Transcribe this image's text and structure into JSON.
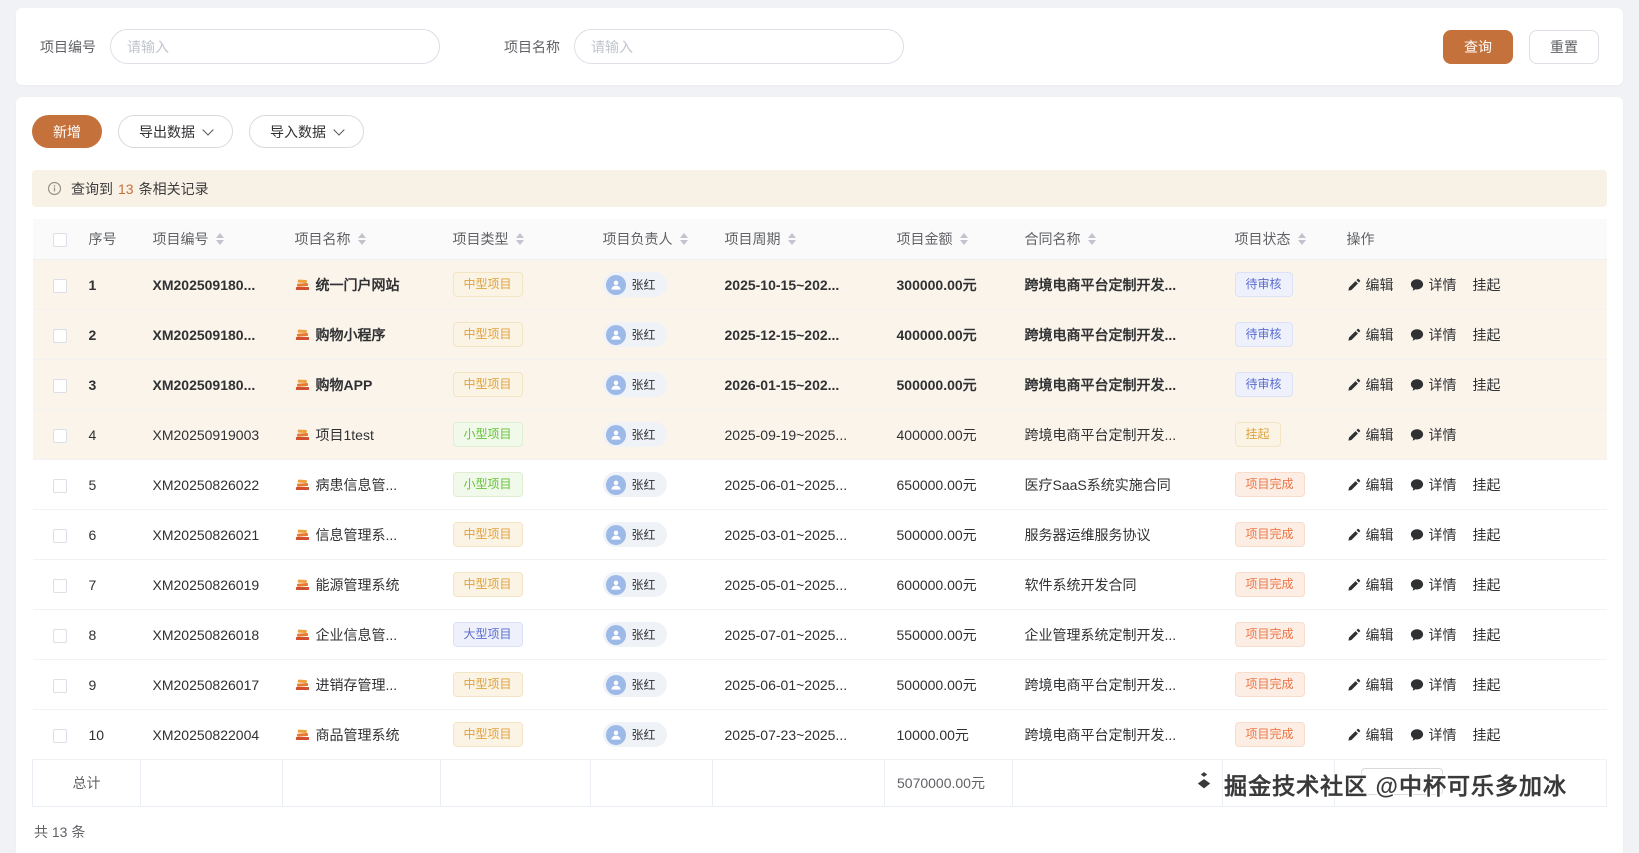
{
  "search": {
    "project_code_label": "项目编号",
    "project_code_placeholder": "请输入",
    "project_name_label": "项目名称",
    "project_name_placeholder": "请输入",
    "query_button": "查询",
    "reset_button": "重置"
  },
  "toolbar": {
    "add_button": "新增",
    "export_button": "导出数据",
    "import_button": "导入数据"
  },
  "alert": {
    "text_prefix": "查询到",
    "count": "13",
    "text_suffix": "条相关记录"
  },
  "table": {
    "columns": [
      {
        "label": "序号",
        "sortable": false
      },
      {
        "label": "项目编号",
        "sortable": true
      },
      {
        "label": "项目名称",
        "sortable": true
      },
      {
        "label": "项目类型",
        "sortable": true
      },
      {
        "label": "项目负责人",
        "sortable": true
      },
      {
        "label": "项目周期",
        "sortable": true
      },
      {
        "label": "项目金额",
        "sortable": true
      },
      {
        "label": "合同名称",
        "sortable": true
      },
      {
        "label": "项目状态",
        "sortable": true
      },
      {
        "label": "操作",
        "sortable": false
      }
    ],
    "action_defs": {
      "edit": {
        "label": "编辑",
        "icon": "pencil-icon"
      },
      "detail": {
        "label": "详情",
        "icon": "chat-icon"
      },
      "suspend": {
        "label": "挂起",
        "icon": null
      }
    },
    "rows": [
      {
        "index": "1",
        "code": "XM202509180...",
        "name": "统一门户网站",
        "type": "中型项目",
        "type_variant": "warning",
        "owner": "张红",
        "period": "2025-10-15~202...",
        "amount": "300000.00元",
        "contract": "跨境电商平台定制开发...",
        "status": "待审核",
        "status_variant": "primary",
        "actions": [
          "edit",
          "detail",
          "suspend"
        ],
        "bold": true,
        "highlight": true
      },
      {
        "index": "2",
        "code": "XM202509180...",
        "name": "购物小程序",
        "type": "中型项目",
        "type_variant": "warning",
        "owner": "张红",
        "period": "2025-12-15~202...",
        "amount": "400000.00元",
        "contract": "跨境电商平台定制开发...",
        "status": "待审核",
        "status_variant": "primary",
        "actions": [
          "edit",
          "detail",
          "suspend"
        ],
        "bold": true,
        "highlight": true
      },
      {
        "index": "3",
        "code": "XM202509180...",
        "name": "购物APP",
        "type": "中型项目",
        "type_variant": "warning",
        "owner": "张红",
        "period": "2026-01-15~202...",
        "amount": "500000.00元",
        "contract": "跨境电商平台定制开发...",
        "status": "待审核",
        "status_variant": "primary",
        "actions": [
          "edit",
          "detail",
          "suspend"
        ],
        "bold": true,
        "highlight": true
      },
      {
        "index": "4",
        "code": "XM20250919003",
        "name": "项目1test",
        "type": "小型项目",
        "type_variant": "success",
        "owner": "张红",
        "period": "2025-09-19~2025...",
        "amount": "400000.00元",
        "contract": "跨境电商平台定制开发...",
        "status": "挂起",
        "status_variant": "warning",
        "actions": [
          "edit",
          "detail"
        ],
        "bold": false,
        "highlight": true
      },
      {
        "index": "5",
        "code": "XM20250826022",
        "name": "病患信息管...",
        "type": "小型项目",
        "type_variant": "success",
        "owner": "张红",
        "period": "2025-06-01~2025...",
        "amount": "650000.00元",
        "contract": "医疗SaaS系统实施合同",
        "status": "项目完成",
        "status_variant": "danger",
        "actions": [
          "edit",
          "detail",
          "suspend"
        ],
        "bold": false,
        "highlight": false
      },
      {
        "index": "6",
        "code": "XM20250826021",
        "name": "信息管理系...",
        "type": "中型项目",
        "type_variant": "warning",
        "owner": "张红",
        "period": "2025-03-01~2025...",
        "amount": "500000.00元",
        "contract": "服务器运维服务协议",
        "status": "项目完成",
        "status_variant": "danger",
        "actions": [
          "edit",
          "detail",
          "suspend"
        ],
        "bold": false,
        "highlight": false
      },
      {
        "index": "7",
        "code": "XM20250826019",
        "name": "能源管理系统",
        "type": "中型项目",
        "type_variant": "warning",
        "owner": "张红",
        "period": "2025-05-01~2025...",
        "amount": "600000.00元",
        "contract": "软件系统开发合同",
        "status": "项目完成",
        "status_variant": "danger",
        "actions": [
          "edit",
          "detail",
          "suspend"
        ],
        "bold": false,
        "highlight": false
      },
      {
        "index": "8",
        "code": "XM20250826018",
        "name": "企业信息管...",
        "type": "大型项目",
        "type_variant": "primary",
        "owner": "张红",
        "period": "2025-07-01~2025...",
        "amount": "550000.00元",
        "contract": "企业管理系统定制开发...",
        "status": "项目完成",
        "status_variant": "danger",
        "actions": [
          "edit",
          "detail",
          "suspend"
        ],
        "bold": false,
        "highlight": false
      },
      {
        "index": "9",
        "code": "XM20250826017",
        "name": "进销存管理...",
        "type": "中型项目",
        "type_variant": "warning",
        "owner": "张红",
        "period": "2025-06-01~2025...",
        "amount": "500000.00元",
        "contract": "跨境电商平台定制开发...",
        "status": "项目完成",
        "status_variant": "danger",
        "actions": [
          "edit",
          "detail",
          "suspend"
        ],
        "bold": false,
        "highlight": false
      },
      {
        "index": "10",
        "code": "XM20250822004",
        "name": "商品管理系统",
        "type": "中型项目",
        "type_variant": "warning",
        "owner": "张红",
        "period": "2025-07-23~2025...",
        "amount": "10000.00元",
        "contract": "跨境电商平台定制开发...",
        "status": "项目完成",
        "status_variant": "danger",
        "actions": [
          "edit",
          "detail",
          "suspend"
        ],
        "bold": false,
        "highlight": false
      }
    ],
    "summary": {
      "label": "总计",
      "amount": "5070000.00元"
    }
  },
  "pagination": {
    "total": "共 13 条"
  },
  "watermark": {
    "text": "掘金技术社区 @中杯可乐多加冰"
  },
  "colors": {
    "primary": "#c4713b",
    "tag_warning": "#e0a13f",
    "tag_success": "#67c23a",
    "tag_primary": "#5a6dd0",
    "tag_danger": "#ec7547",
    "row_highlight": "#faf4eb"
  }
}
